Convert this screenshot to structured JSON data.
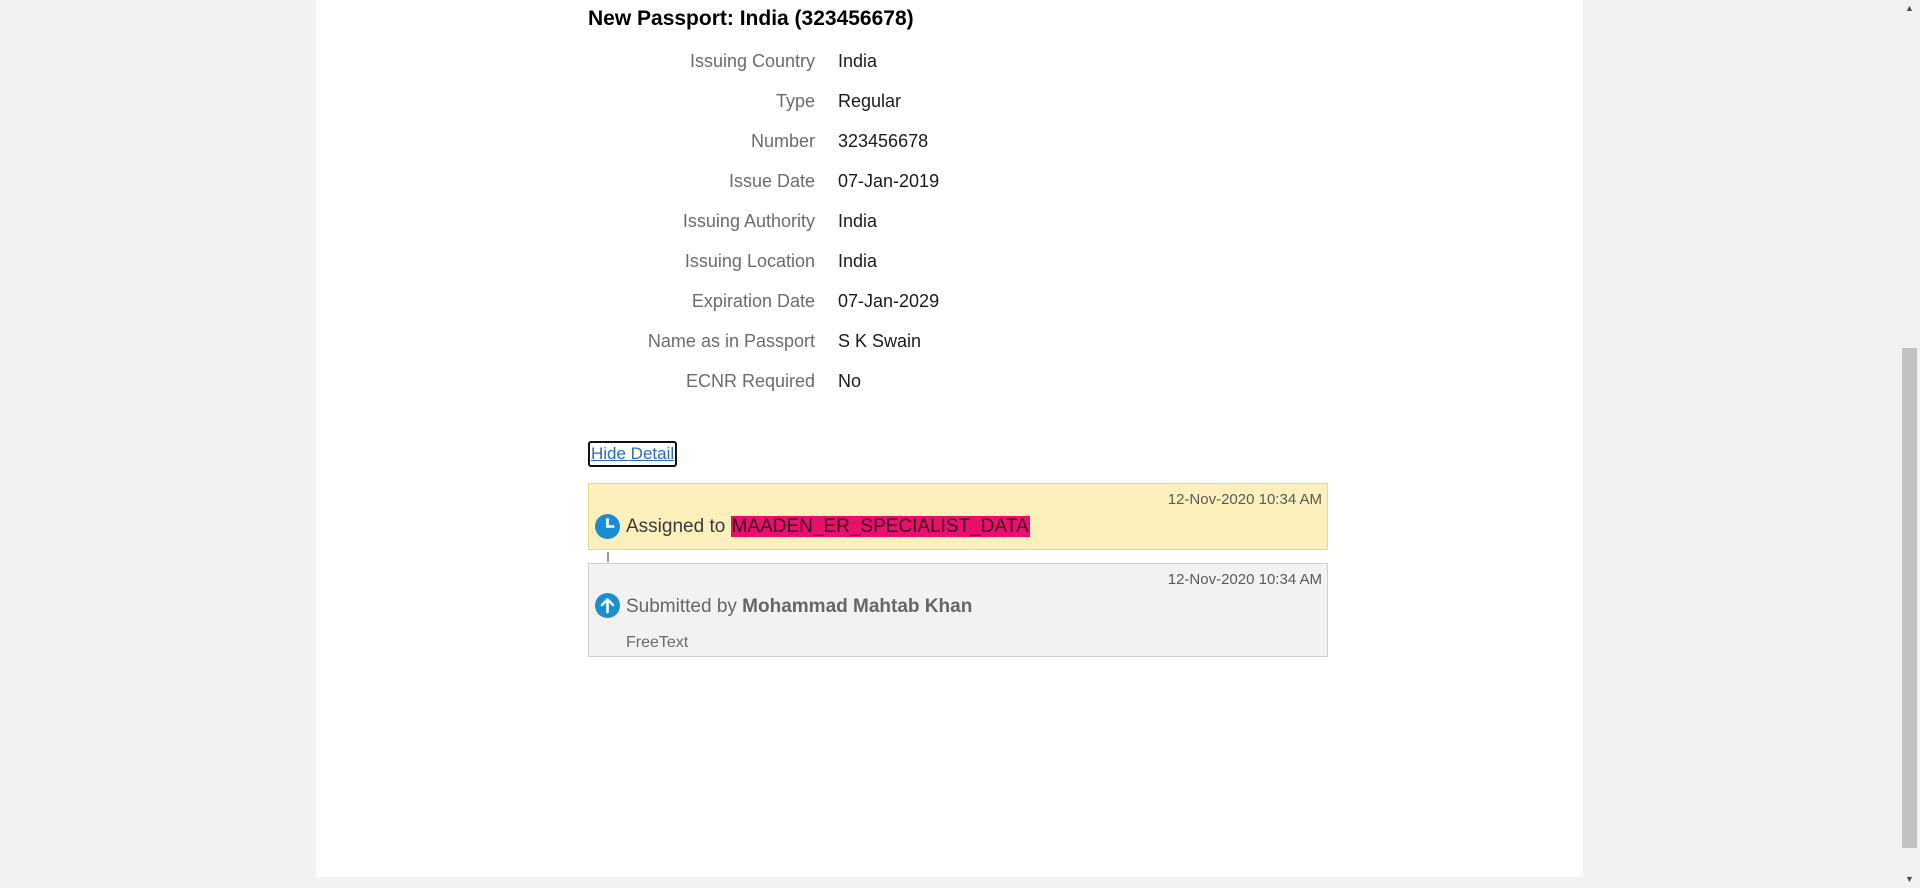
{
  "passport": {
    "title": "New Passport: India (323456678)",
    "fields": [
      {
        "label": "Issuing Country",
        "value": "India"
      },
      {
        "label": "Type",
        "value": "Regular"
      },
      {
        "label": "Number",
        "value": "323456678"
      },
      {
        "label": "Issue Date",
        "value": "07-Jan-2019"
      },
      {
        "label": "Issuing Authority",
        "value": "India"
      },
      {
        "label": "Issuing Location",
        "value": "India"
      },
      {
        "label": "Expiration Date",
        "value": "07-Jan-2029"
      },
      {
        "label": "Name as in Passport",
        "value": "S K Swain"
      },
      {
        "label": "ECNR Required",
        "value": "No"
      }
    ]
  },
  "hide_detail_label": "Hide Detail",
  "history": [
    {
      "timestamp": "12-Nov-2020 10:34 AM",
      "action_prefix": "Assigned to ",
      "actor": "MAADEN_ER_SPECIALIST_DATA",
      "icon": "clock-icon",
      "highlight_color": "#e8106b",
      "background": "#fcf0bd"
    },
    {
      "timestamp": "12-Nov-2020 10:34 AM",
      "action_prefix": "Submitted by ",
      "actor": "Mohammad Mahtab Khan",
      "comment": "FreeText",
      "icon": "arrow-up-icon",
      "background": "#f2f2f2"
    }
  ],
  "colors": {
    "icon_blue": "#1a8fcf",
    "link": "#2a6fae"
  }
}
